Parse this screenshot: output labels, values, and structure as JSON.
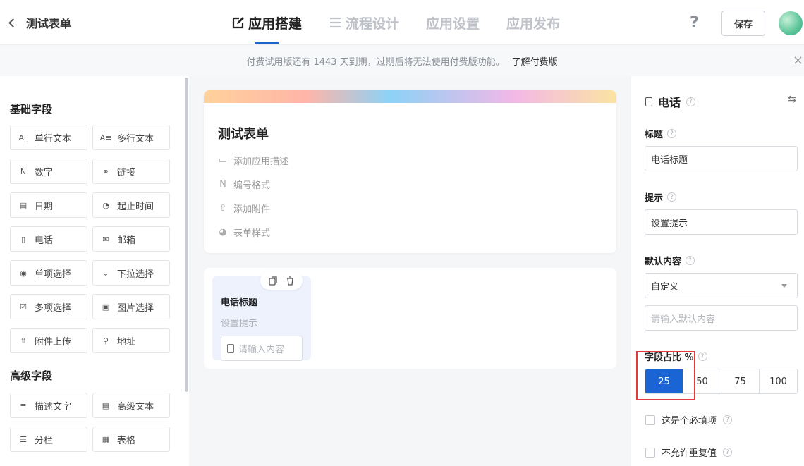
{
  "header": {
    "form_name": "测试表单",
    "tabs": [
      {
        "label": "应用搭建",
        "active": true,
        "icon": "edit-icon"
      },
      {
        "label": "流程设计",
        "active": false,
        "icon": "flow-icon"
      },
      {
        "label": "应用设置",
        "active": false
      },
      {
        "label": "应用发布",
        "active": false
      }
    ],
    "help": "?",
    "save_label": "保存"
  },
  "notice": {
    "text": "付费试用版还有 1443 天到期，过期后将无法使用付费版功能。",
    "link": "了解付费版",
    "close": "×"
  },
  "left": {
    "basic_title": "基础字段",
    "basic": [
      {
        "label": "单行文本",
        "icon": "single-line-text-icon",
        "glyph": "A_"
      },
      {
        "label": "多行文本",
        "icon": "multi-line-text-icon",
        "glyph": "A≡"
      },
      {
        "label": "数字",
        "icon": "number-icon",
        "glyph": "N"
      },
      {
        "label": "链接",
        "icon": "link-icon",
        "glyph": "⚭"
      },
      {
        "label": "日期",
        "icon": "date-icon",
        "glyph": "▤"
      },
      {
        "label": "起止时间",
        "icon": "time-range-icon",
        "glyph": "◔"
      },
      {
        "label": "电话",
        "icon": "phone-icon",
        "glyph": "▯"
      },
      {
        "label": "邮箱",
        "icon": "email-icon",
        "glyph": "✉"
      },
      {
        "label": "单项选择",
        "icon": "radio-icon",
        "glyph": "◉"
      },
      {
        "label": "下拉选择",
        "icon": "dropdown-icon",
        "glyph": "⌄"
      },
      {
        "label": "多项选择",
        "icon": "checkbox-icon",
        "glyph": "☑"
      },
      {
        "label": "图片选择",
        "icon": "image-icon",
        "glyph": "▣"
      },
      {
        "label": "附件上传",
        "icon": "upload-icon",
        "glyph": "⇧"
      },
      {
        "label": "地址",
        "icon": "address-icon",
        "glyph": "⚲"
      }
    ],
    "advanced_title": "高级字段",
    "advanced": [
      {
        "label": "描述文字",
        "icon": "description-icon",
        "glyph": "≡"
      },
      {
        "label": "高级文本",
        "icon": "rich-text-icon",
        "glyph": "▤"
      },
      {
        "label": "分栏",
        "icon": "columns-icon",
        "glyph": "☰"
      },
      {
        "label": "表格",
        "icon": "table-icon",
        "glyph": "▦"
      }
    ]
  },
  "center": {
    "form_title": "测试表单",
    "options": [
      {
        "label": "添加应用描述",
        "icon": "comment-icon",
        "glyph": "▭"
      },
      {
        "label": "编号格式",
        "icon": "number-format-icon",
        "glyph": "N"
      },
      {
        "label": "添加附件",
        "icon": "attachment-upload-icon",
        "glyph": "⇧"
      },
      {
        "label": "表单样式",
        "icon": "palette-icon",
        "glyph": "◕"
      }
    ],
    "field": {
      "label": "电话标题",
      "hint": "设置提示",
      "placeholder": "请输入内容"
    }
  },
  "right": {
    "title": "电话",
    "label_title": "标题",
    "title_value": "电话标题",
    "label_hint": "提示",
    "hint_value": "设置提示",
    "label_default": "默认内容",
    "default_mode": "自定义",
    "default_placeholder": "请输入默认内容",
    "label_width": "字段占比 %",
    "width_options": [
      "25",
      "50",
      "75",
      "100"
    ],
    "width_selected": "25",
    "required_label": "这是个必填项",
    "unique_label": "不允许重复值",
    "colors": {
      "accent": "#1a64d4",
      "highlight_box": "#e03a3a"
    }
  }
}
